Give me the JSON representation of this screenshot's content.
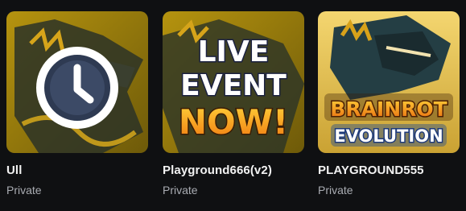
{
  "games": [
    {
      "title": "Ull",
      "status": "Private",
      "thumbnail_icon": "clock-icon",
      "thumbnail_text": []
    },
    {
      "title": "Playground666(v2)",
      "status": "Private",
      "thumbnail_icon": "live-event-banner",
      "thumbnail_text": [
        "LIVE",
        "EVENT",
        "NOW!"
      ]
    },
    {
      "title": "PLAYGROUND555",
      "status": "Private",
      "thumbnail_icon": "brainrot-evolution-logo",
      "thumbnail_text": [
        "BRAINROT",
        "EVOLUTION"
      ]
    }
  ],
  "colors": {
    "background": "#0f1012",
    "thumb_gold": "#a8880c",
    "thumb_dark": "#2a3128",
    "accent_orange": "#f6a21a",
    "text_primary": "#f2f2f2",
    "text_secondary": "#a9acb2"
  }
}
